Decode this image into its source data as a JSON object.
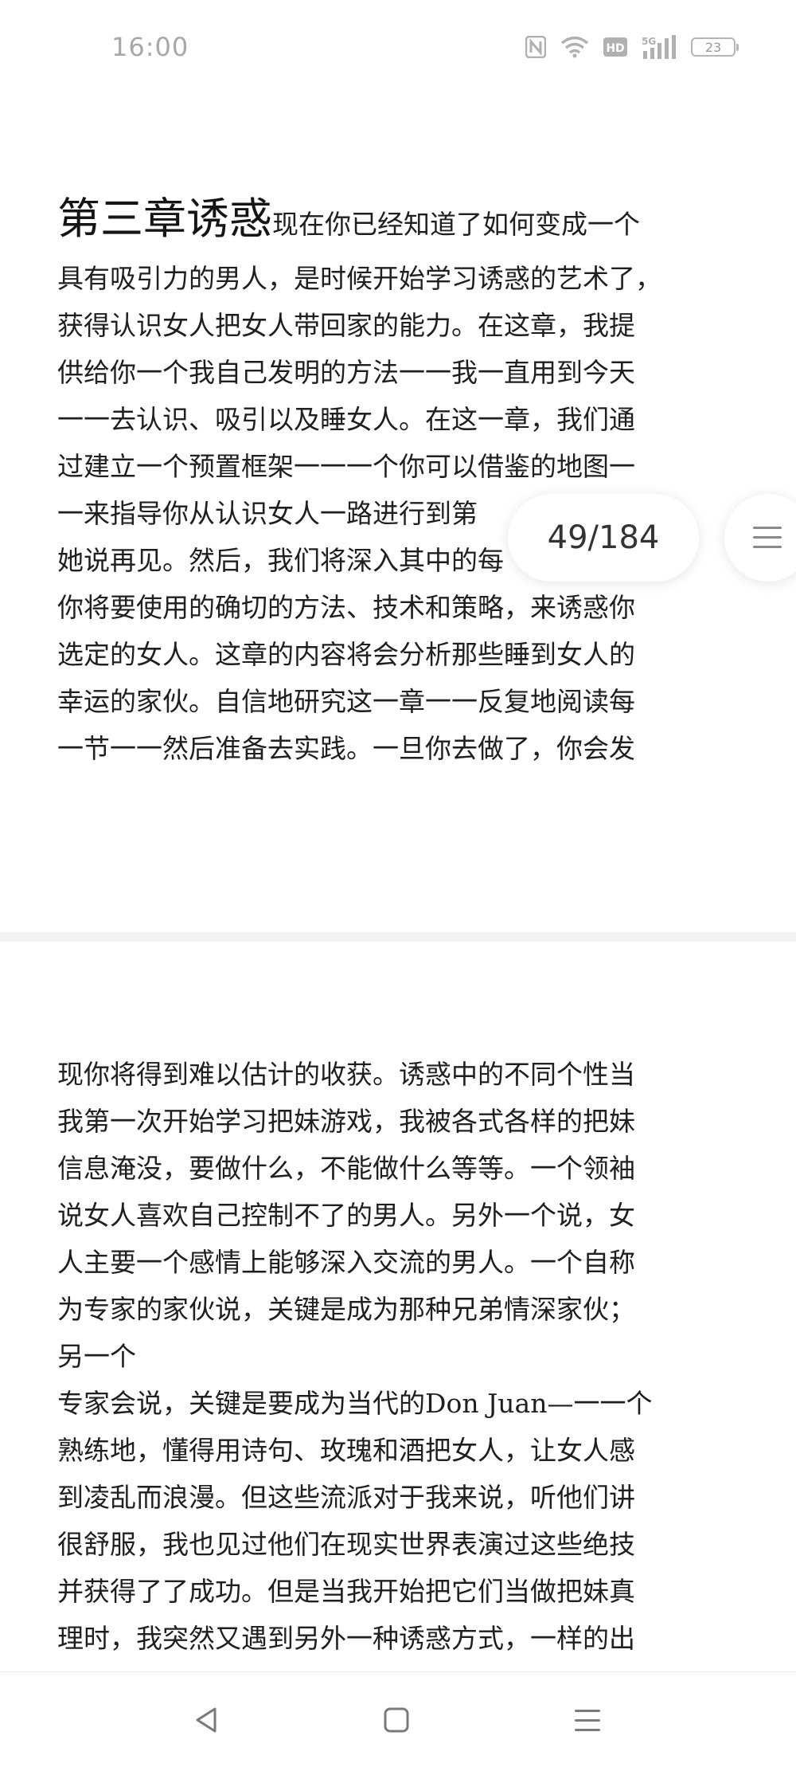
{
  "status_bar": {
    "time": "16:00",
    "battery": "23",
    "icons": [
      "nfc-icon",
      "wifi-icon",
      "hd-icon",
      "5g-signal-icon",
      "battery-icon"
    ]
  },
  "reader": {
    "chapter_title": "第三章诱惑",
    "page1_first_line": "现在你已经知道了如何变成一个",
    "page1_lines": [
      "具有吸引力的男人，是时候开始学习诱惑的艺术了，",
      "获得认识女人把女人带回家的能力。在这章，我提",
      "供给你一个我自己发明的方法一一我一直用到今天",
      "一一去认识、吸引以及睡女人。在这一章，我们通",
      "过建立一个预置框架一一一个你可以借鉴的地图一",
      "一来指导你从认识女人一路进行到第",
      "她说再见。然后，我们将深入其中的每",
      "你将要使用的确切的方法、技术和策略，来诱惑你",
      "选定的女人。这章的内容将会分析那些睡到女人的",
      "幸运的家伙。自信地研究这一章一一反复地阅读每",
      "一节一一然后准备去实践。一旦你去做了，你会发"
    ],
    "page2_lines": [
      "现你将得到难以估计的收获。诱惑中的不同个性当",
      "我第一次开始学习把妹游戏，我被各式各样的把妹",
      "信息淹没，要做什么，不能做什么等等。一个领袖",
      "说女人喜欢自己控制不了的男人。另外一个说，女",
      "人主要一个感情上能够深入交流的男人。一个自称",
      "为专家的家伙说，关键是成为那种兄弟情深家伙；",
      "另一个",
      "专家会说，关键是要成为当代的Don Juan—一一个",
      "熟练地，懂得用诗句、玫瑰和酒把女人，让女人感",
      "到凌乱而浪漫。但这些流派对于我来说，听他们讲",
      "很舒服，我也见过他们在现实世界表演过这些绝技",
      "并获得了了成功。但是当我开始把它们当做把妹真",
      "理时，我突然又遇到另外一种诱惑方式，一样的出"
    ],
    "page_indicator": "49/184"
  },
  "nav": {
    "icons": [
      "back-triangle-icon",
      "home-square-icon",
      "menu-lines-icon"
    ]
  }
}
